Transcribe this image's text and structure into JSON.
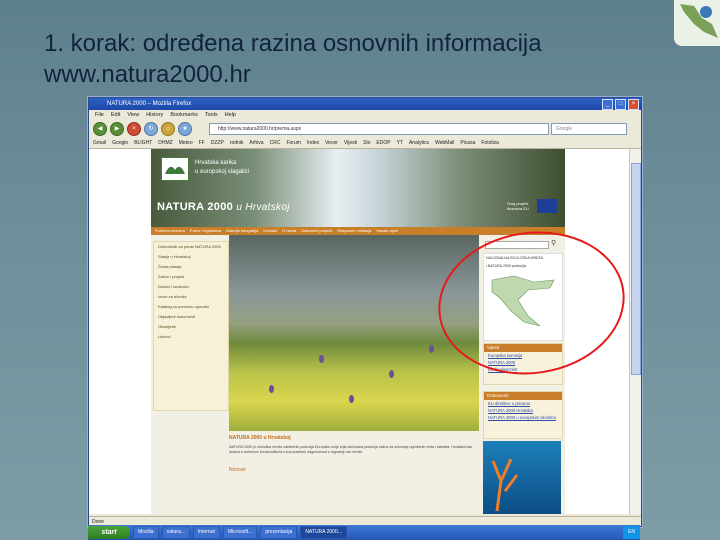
{
  "slide": {
    "title_line1": "1. korak: određena razina osnovnih informacija",
    "title_line2": "www.natura2000.hr"
  },
  "browser": {
    "window_title": "NATURA 2000 – Mozilla Firefox",
    "menu": [
      "File",
      "Edit",
      "View",
      "History",
      "Bookmarks",
      "Tools",
      "Help"
    ],
    "url": "http://www.natura2000.hr/prema.aspx",
    "search_placeholder": "Google",
    "bookmarks": [
      "Gmail",
      "Google",
      "BLIGHT",
      "DHMZ",
      "Meteo",
      "FF",
      "DZZP",
      "rodnik",
      "Arhiva",
      "CRC",
      "Forum",
      "Index",
      "Vecer",
      "Vijesti",
      "Slo",
      "EDOP",
      "YT",
      "Analytics",
      "WebMail",
      "Picasa",
      "Fotoliza"
    ],
    "status": "Done"
  },
  "site": {
    "tagline_line1": "Hrvatska karika",
    "tagline_line2": "u europskoj slagalici",
    "brand": "NATURA 2000",
    "brand_sub": "u Hrvatskoj",
    "eu_text": "Ovaj projekt financira EU",
    "nav": [
      "Početna stranica",
      "Pravo i legislativa",
      "Galerija fotografija",
      "Kontakt",
      "O nama",
      "Ostvareni projekti",
      "Rasprave i očitanja",
      "Kazalo riječi"
    ],
    "left_menu": [
      "Dobrodošli na portal NATURA 2000",
      "Stanje u Hrvatskoj",
      "Česta pitanja",
      "Zakon i propisi",
      "Dionici i sudionici",
      "Izvori za dionike",
      "Katalog za ponovnu uporabu",
      "Objavljeni dokumenti",
      "Obavijesti",
      "Linkovi"
    ],
    "article_title": "NATURA 2000 u Hrvatskoj",
    "article_text": "NATURA 2000 je ekološka mreža zaštićenih područja Europske unije koja obuhvaća područja važna za očuvanje ugroženih vrsta i staništa. Hrvatska kao država s iznimnom bioraznolikošću ima posebnu odgovornost u izgradnji ove mreže.",
    "news_title": "Novosti",
    "map_title": "NACIONALNA EKOLOŠKA MREŽA",
    "map_sub": "i NATURA 2000 područja",
    "links_header": "Vijesti",
    "links": [
      "Europska komisija",
      "NATURA 2000",
      "EU biodiverzitet"
    ],
    "docs_header": "Dokumenti",
    "docs": [
      "EU direktive o pticama",
      "NATURA 2000 Hrvatska",
      "NATURA 2000 u europskim okvirima"
    ]
  },
  "taskbar": {
    "start": "start",
    "items": [
      "Mozilla",
      "natura...",
      "Internet",
      "Microsoft...",
      "prezentacija",
      "NATURA 2000..."
    ],
    "tray": "EN"
  },
  "colors": {
    "annotation": "#e51a1a",
    "accent": "#c97f2a",
    "titlebar": "#1c47a8"
  }
}
